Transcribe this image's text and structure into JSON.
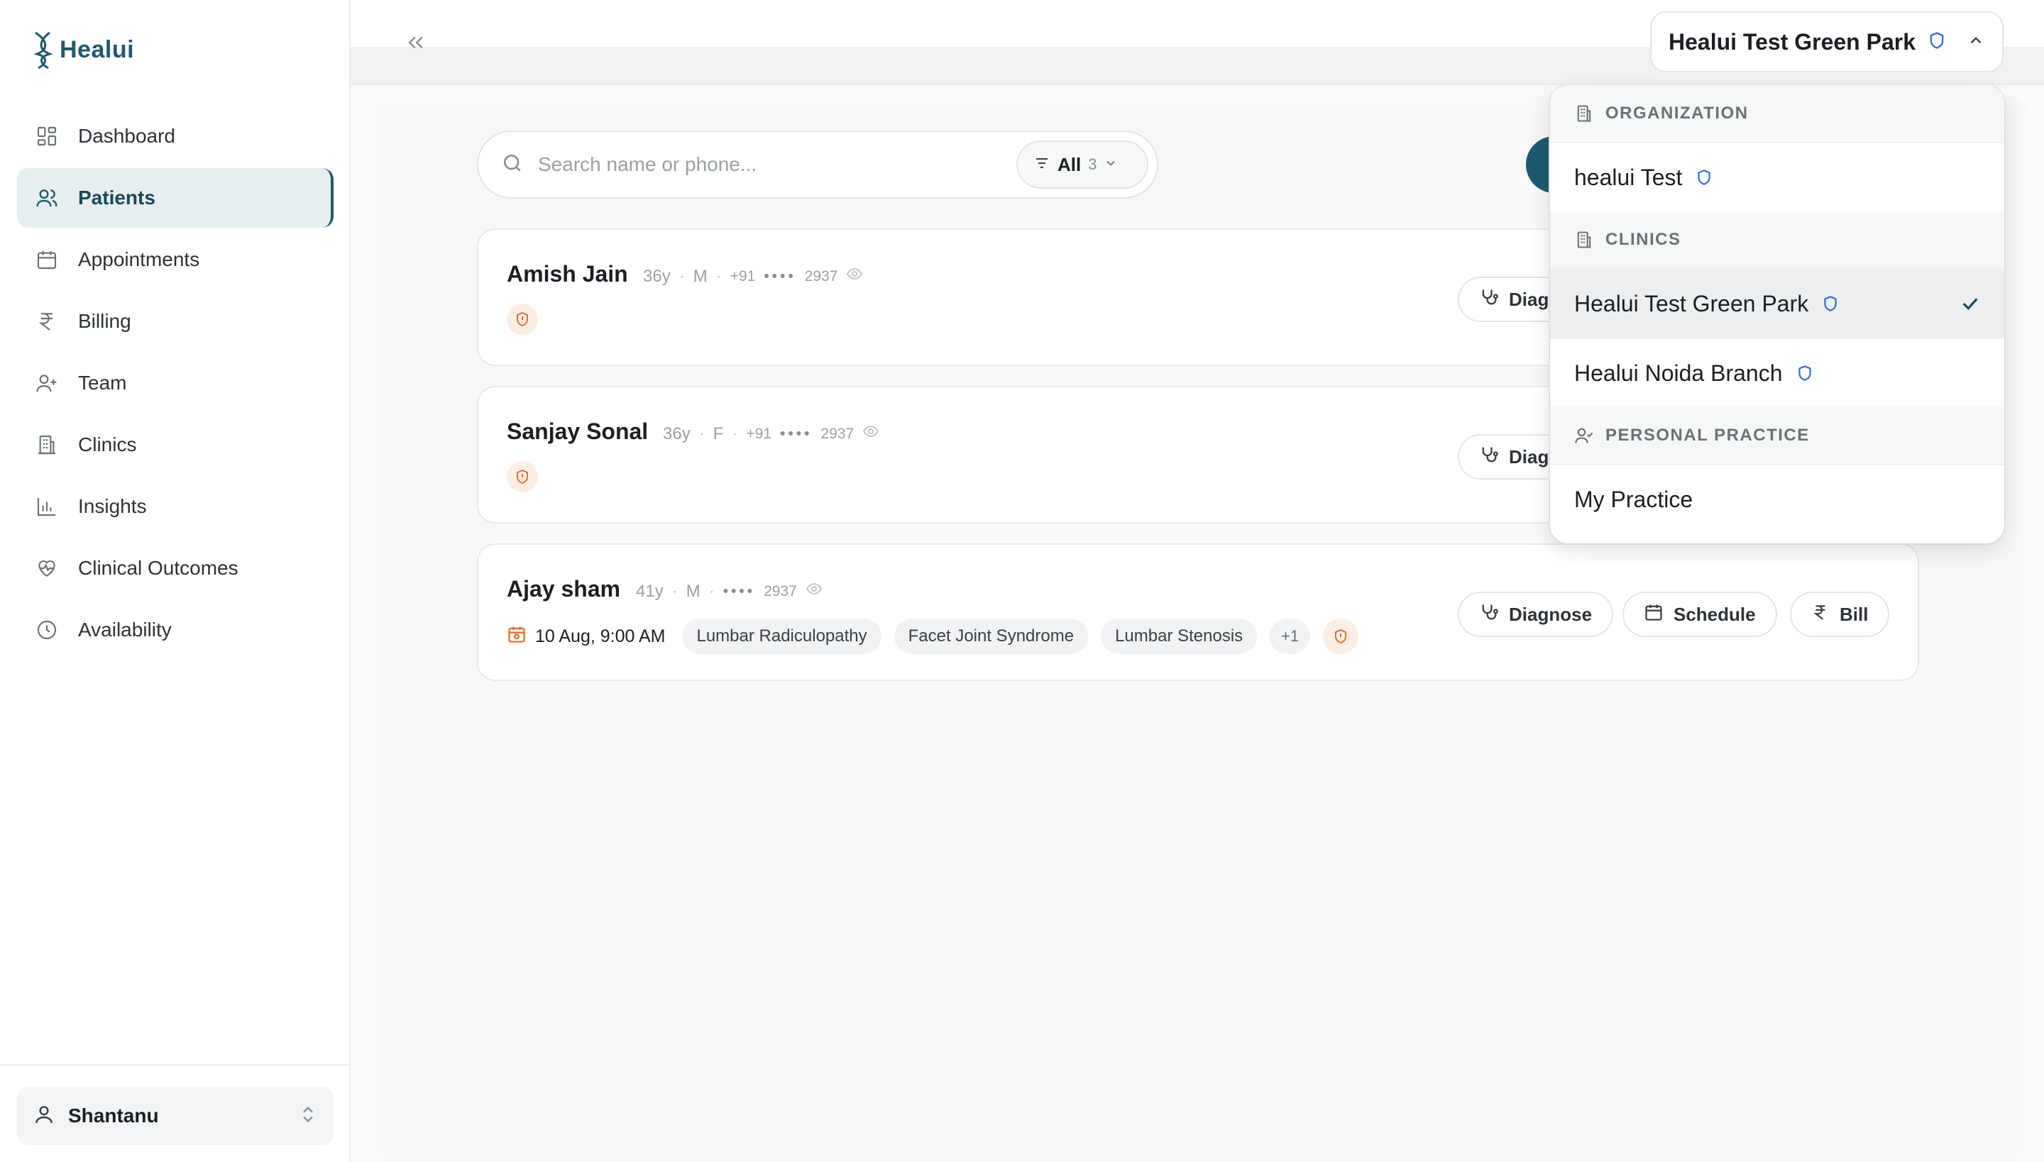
{
  "app": {
    "name": "Healui"
  },
  "sidebar": {
    "items": [
      {
        "label": "Dashboard",
        "icon": "dashboard-icon"
      },
      {
        "label": "Patients",
        "icon": "users-icon",
        "active": true
      },
      {
        "label": "Appointments",
        "icon": "calendar-icon"
      },
      {
        "label": "Billing",
        "icon": "rupee-icon"
      },
      {
        "label": "Team",
        "icon": "user-plus-icon"
      },
      {
        "label": "Clinics",
        "icon": "building-icon"
      },
      {
        "label": "Insights",
        "icon": "bar-chart-icon"
      },
      {
        "label": "Clinical Outcomes",
        "icon": "heart-pulse-icon"
      },
      {
        "label": "Availability",
        "icon": "clock-icon"
      }
    ],
    "user": {
      "name": "Shantanu"
    }
  },
  "header": {
    "org_switch": {
      "label": "Healui Test Green Park",
      "verified": true
    }
  },
  "search": {
    "placeholder": "Search name or phone...",
    "filter": {
      "label": "All",
      "count": "3"
    }
  },
  "patients": [
    {
      "name": "Amish Jain",
      "age": "36y",
      "gender": "M",
      "phone_prefix": "+91",
      "phone_mask": "••••",
      "phone_last": "2937",
      "appointment": null,
      "tags": [],
      "more": null,
      "actions": [
        "Diagnose"
      ]
    },
    {
      "name": "Sanjay Sonal",
      "age": "36y",
      "gender": "F",
      "phone_prefix": "+91",
      "phone_mask": "••••",
      "phone_last": "2937",
      "appointment": null,
      "tags": [],
      "more": null,
      "actions": [
        "Diagnose"
      ]
    },
    {
      "name": "Ajay sham",
      "age": "41y",
      "gender": "M",
      "phone_prefix": "",
      "phone_mask": "••••",
      "phone_last": "2937",
      "appointment": "10 Aug, 9:00 AM",
      "tags": [
        "Lumbar Radiculopathy",
        "Facet Joint Syndrome",
        "Lumbar Stenosis"
      ],
      "more": "+1",
      "actions": [
        "Diagnose",
        "Schedule",
        "Bill"
      ]
    }
  ],
  "dropdown": {
    "sections": [
      {
        "title": "ORGANIZATION",
        "icon": "building-icon",
        "items": [
          {
            "label": "healui Test",
            "verified": true
          }
        ]
      },
      {
        "title": "CLINICS",
        "icon": "building-icon",
        "items": [
          {
            "label": "Healui Test Green Park",
            "verified": true,
            "selected": true
          },
          {
            "label": "Healui Noida Branch",
            "verified": true
          }
        ]
      },
      {
        "title": "PERSONAL PRACTICE",
        "icon": "user-check-icon",
        "items": [
          {
            "label": "My Practice",
            "verified": false
          }
        ]
      }
    ]
  },
  "colors": {
    "brand": "#1e5a6e",
    "active_nav_bg": "#e6eef0",
    "verified_shield": "#2f6fd6",
    "risk_orange": "#e2702f"
  }
}
